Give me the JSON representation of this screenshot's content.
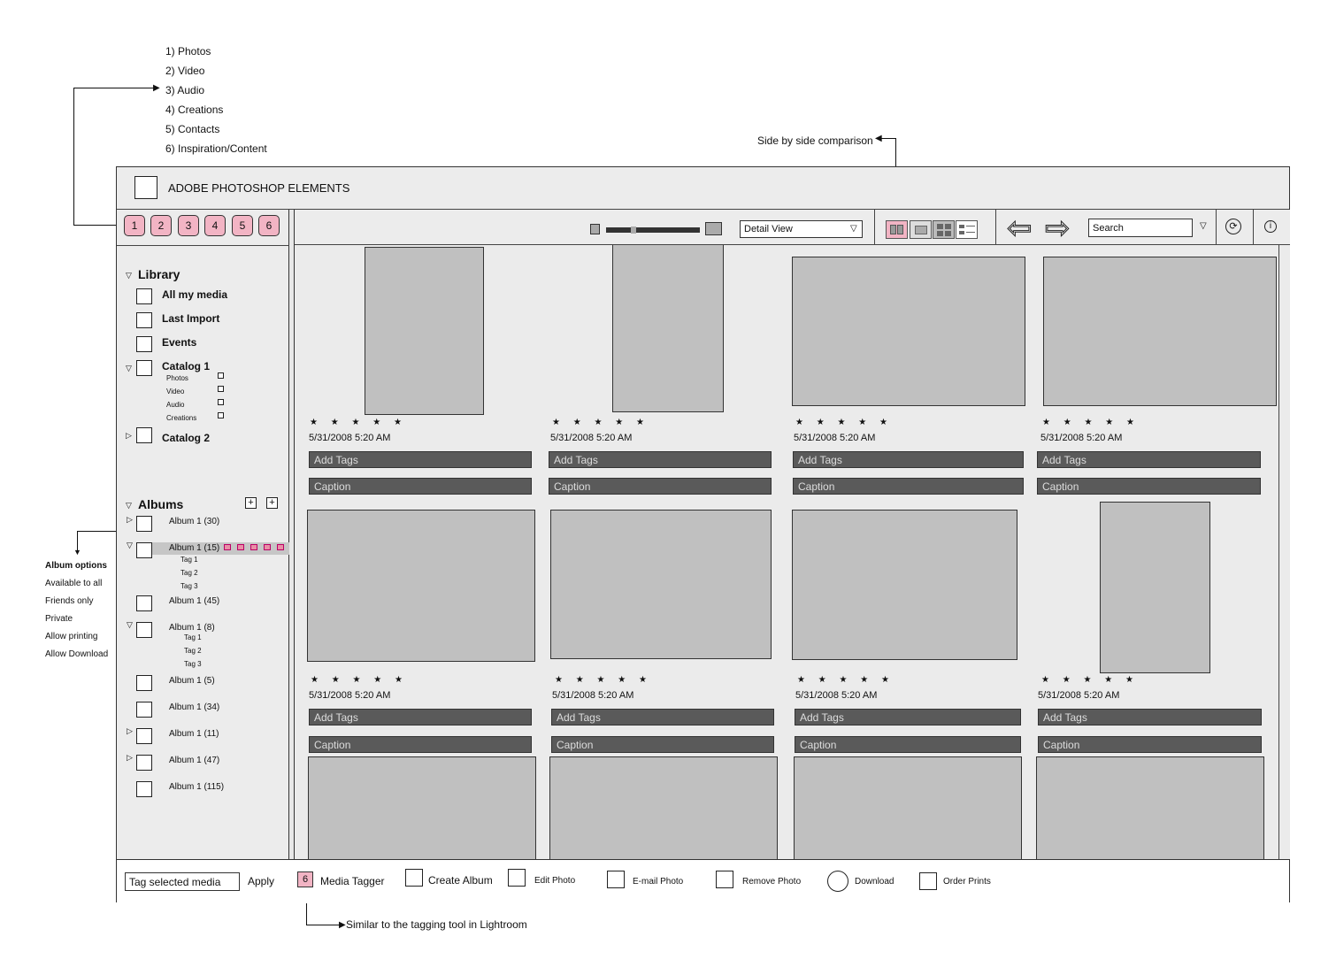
{
  "annotations": {
    "menu_list": [
      "1) Photos",
      "2) Video",
      "3) Audio",
      "4) Creations",
      "5) Contacts",
      "6) Inspiration/Content"
    ],
    "side_by_side": "Side by side comparison",
    "album_options_title": "Album options",
    "album_options": [
      "Available to all",
      "Friends only",
      "Private",
      "Allow printing",
      "Allow Download"
    ],
    "tagger_note": "Similar to the tagging tool in Lightroom"
  },
  "app": {
    "title": "ADOBE PHOTOSHOP ELEMENTS",
    "nav_buttons": [
      "1",
      "2",
      "3",
      "4",
      "5",
      "6"
    ],
    "view_select": "Detail View",
    "search_placeholder": "Search",
    "info_icon": "info-icon",
    "sync_icon": "sync-icon"
  },
  "sidebar": {
    "library_label": "Library",
    "library_items": [
      "All my media",
      "Last Import",
      "Events",
      "Catalog 1"
    ],
    "catalog1_children": [
      "Photos",
      "Video",
      "Audio",
      "Creations"
    ],
    "catalog2": "Catalog 2",
    "albums_label": "Albums",
    "albums": [
      "Album 1 (30)",
      "Album 1 (15)",
      "Album 1 (45)",
      "Album 1 (8)",
      "Album 1 (5)",
      "Album 1 (34)",
      "Album 1 (11)",
      "Album 1 (47)",
      "Album 1 (115)"
    ],
    "album15_tags": [
      "Tag 1",
      "Tag 2",
      "Tag 3"
    ],
    "album8_tags": [
      "Tag 1",
      "Tag 2",
      "Tag 3"
    ]
  },
  "media": {
    "stars": "★ ★ ★ ★ ★",
    "date": "5/31/2008 5:20 AM",
    "tags_placeholder": "Add Tags",
    "caption_placeholder": "Caption"
  },
  "bottom": {
    "tag_input": "Tag selected media",
    "apply": "Apply",
    "tagger_badge": "6",
    "media_tagger": "Media Tagger",
    "create_album": "Create Album",
    "edit_photo": "Edit Photo",
    "email_photo": "E-mail Photo",
    "remove_photo": "Remove Photo",
    "download": "Download",
    "order_prints": "Order Prints"
  }
}
